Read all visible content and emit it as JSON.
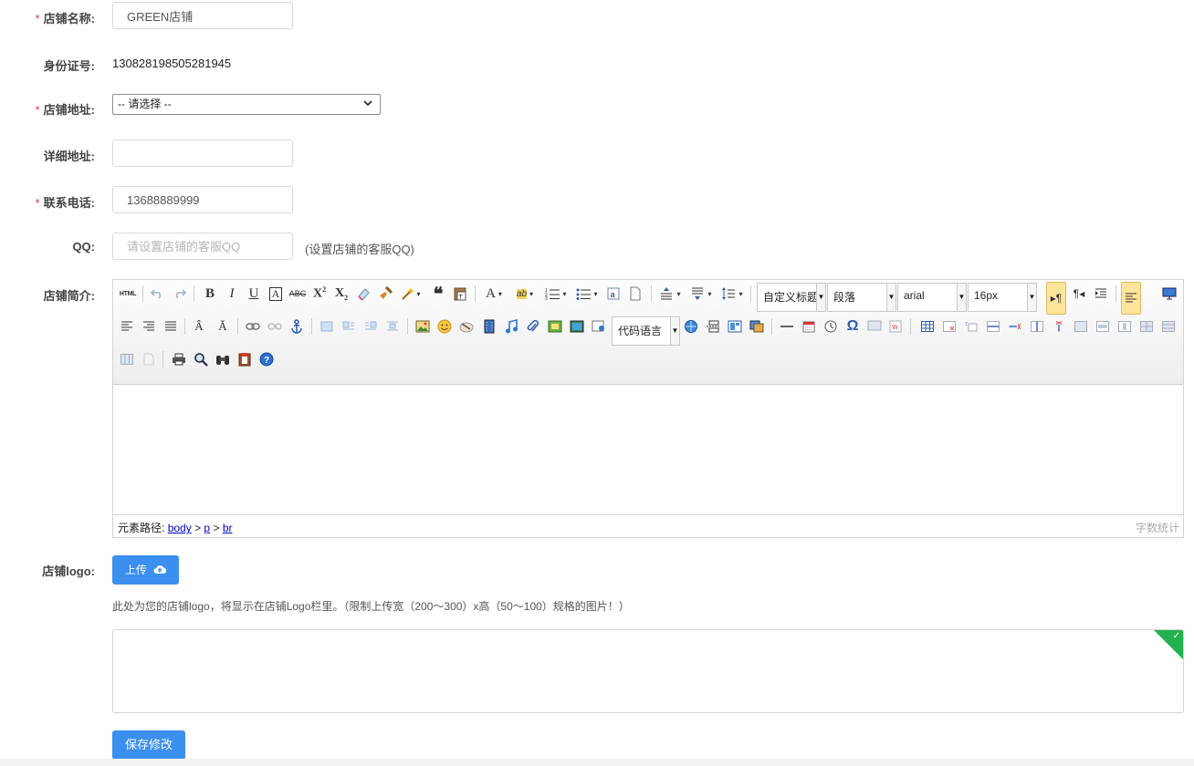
{
  "form": {
    "shop_name": {
      "label": "店铺名称:",
      "value": "GREEN店铺",
      "required": true
    },
    "id_number": {
      "label": "身份证号:",
      "value": "130828198505281945"
    },
    "shop_address": {
      "label": "店铺地址:",
      "selected": "-- 请选择 --",
      "required": true
    },
    "detail_address": {
      "label": "详细地址:",
      "value": ""
    },
    "phone": {
      "label": "联系电话:",
      "value": "13688889999",
      "required": true
    },
    "qq": {
      "label": "QQ:",
      "placeholder": "请设置店铺的客服QQ",
      "hint": "(设置店铺的客服QQ)"
    },
    "intro": {
      "label": "店铺简介:"
    },
    "logo": {
      "label": "店铺logo:",
      "upload_label": "上传",
      "hint": "此处为您的店铺logo，将显示在店铺Logo栏里。（限制上传宽（200～300）x高（50～100）规格的图片！）"
    },
    "save_label": "保存修改"
  },
  "editor": {
    "combos": {
      "heading": "自定义标题",
      "paragraph": "段落",
      "font": "arial",
      "size": "16px",
      "code": "代码语言"
    },
    "source_label": "HTML",
    "status": {
      "path_label": "元素路径:",
      "path": [
        "body",
        "p",
        "br"
      ],
      "separator": ">",
      "word_count": "字数统计"
    }
  },
  "colors": {
    "required": "#e4393c",
    "primary": "#3b8fef",
    "success_corner": "#23b14d"
  }
}
